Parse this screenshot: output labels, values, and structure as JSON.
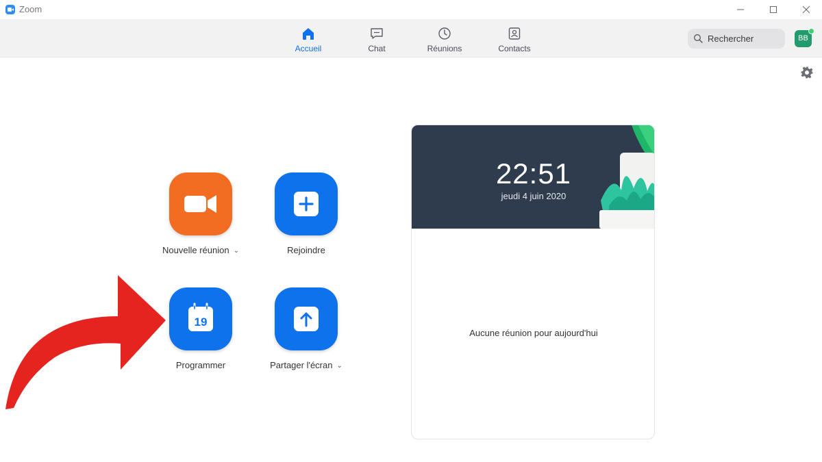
{
  "window": {
    "title": "Zoom"
  },
  "nav": {
    "tabs": [
      {
        "label": "Accueil",
        "icon": "home-icon",
        "active": true
      },
      {
        "label": "Chat",
        "icon": "chat-icon",
        "active": false
      },
      {
        "label": "Réunions",
        "icon": "clock-icon",
        "active": false
      },
      {
        "label": "Contacts",
        "icon": "contacts-icon",
        "active": false
      }
    ],
    "search_placeholder": "Rechercher",
    "avatar_initials": "BB"
  },
  "actions": {
    "new_meeting": "Nouvelle réunion",
    "join": "Rejoindre",
    "schedule": "Programmer",
    "schedule_day": "19",
    "share_screen": "Partager l'écran"
  },
  "panel": {
    "time": "22:51",
    "date": "jeudi 4 juin 2020",
    "empty_message": "Aucune réunion pour aujourd'hui"
  },
  "colors": {
    "accent": "#0e72ed",
    "orange": "#f26d21",
    "header_bg": "#2e3c4e",
    "annotation_arrow": "#e52420"
  }
}
